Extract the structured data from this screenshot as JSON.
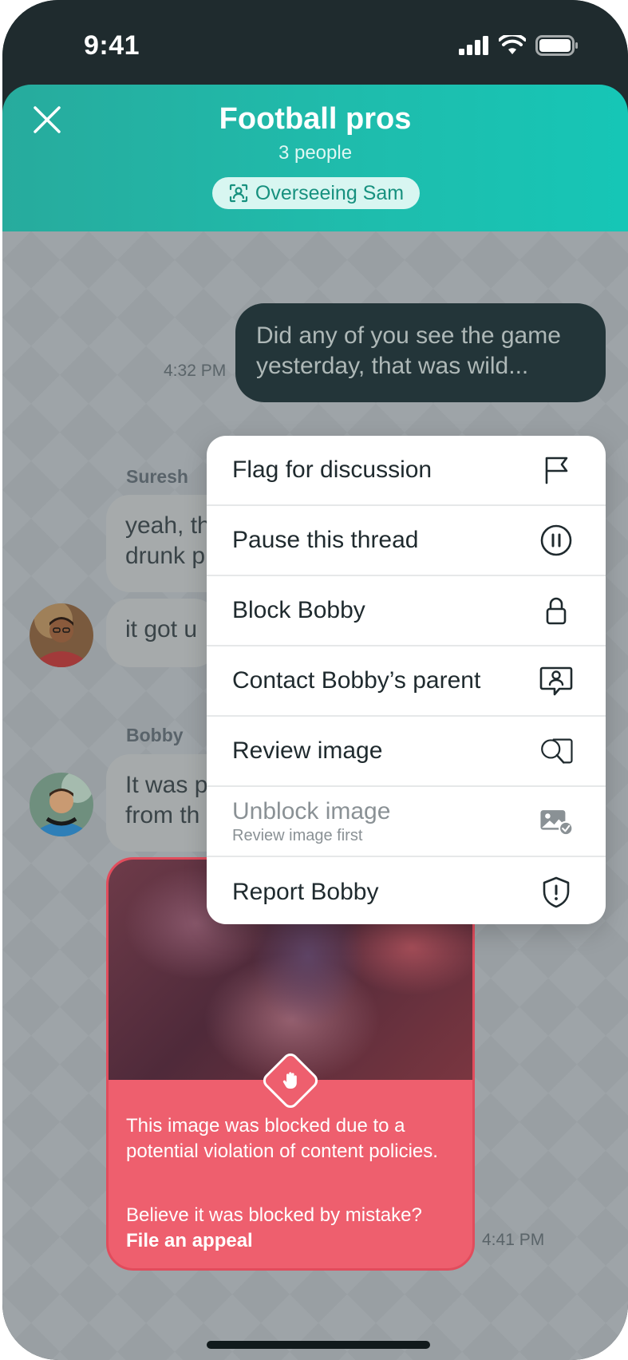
{
  "status_bar": {
    "time": "9:41"
  },
  "header": {
    "title": "Football pros",
    "subtitle": "3 people",
    "overseeing_label": "Overseeing Sam",
    "accent_color": "#1fbcac"
  },
  "messages": {
    "outgoing": {
      "text": "Did any of you see the game yesterday, that was wild...",
      "time": "4:32 PM"
    },
    "suresh": {
      "sender": "Suresh",
      "line1": "yeah, th",
      "line1b": "drunk p",
      "line2": "it got u"
    },
    "bobby": {
      "sender": "Bobby",
      "line1": "It was p",
      "line1b": "from th"
    },
    "blocked_card": {
      "notice": "This image was blocked due to a potential violation of content policies.",
      "appeal_question": "Believe it was blocked by mistake?",
      "appeal_link": "File an appeal",
      "time": "4:41 PM",
      "color": "#ee5f6e"
    }
  },
  "context_menu": {
    "items": [
      {
        "label": "Flag for discussion",
        "icon": "flag-icon"
      },
      {
        "label": "Pause this thread",
        "icon": "pause-circle-icon"
      },
      {
        "label": "Block Bobby",
        "icon": "lock-icon"
      },
      {
        "label": "Contact Bobby’s parent",
        "icon": "contact-parent-icon"
      },
      {
        "label": "Review image",
        "icon": "review-image-icon"
      },
      {
        "label": "Unblock image",
        "sub": "Review image first",
        "icon": "unblock-image-icon",
        "disabled": true
      },
      {
        "label": "Report Bobby",
        "icon": "shield-alert-icon"
      }
    ]
  }
}
